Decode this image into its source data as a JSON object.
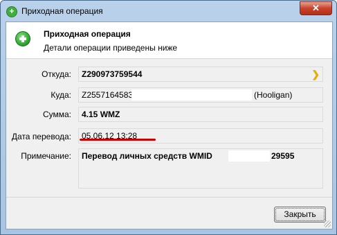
{
  "window": {
    "title": "Приходная операция",
    "close_label": "✕"
  },
  "header": {
    "title": "Приходная операция",
    "subtitle": "Детали операции приведены ниже"
  },
  "fields": {
    "from": {
      "label": "Откуда:",
      "value": "Z290973759544"
    },
    "to": {
      "label": "Куда:",
      "value": "Z2557164583",
      "suffix": "(Hooligan)"
    },
    "amount": {
      "label": "Сумма:",
      "value": "4.15 WMZ"
    },
    "date": {
      "label": "Дата перевода:",
      "value": "05.06.12 13:28"
    },
    "note": {
      "label": "Примечание:",
      "value": "Перевод личных средств WMID",
      "value_tail": "29595"
    }
  },
  "buttons": {
    "close": "Закрыть"
  },
  "colors": {
    "accent_green": "#2fa32f",
    "underline_red": "#cc0000",
    "arrow_yellow": "#e0b000"
  }
}
